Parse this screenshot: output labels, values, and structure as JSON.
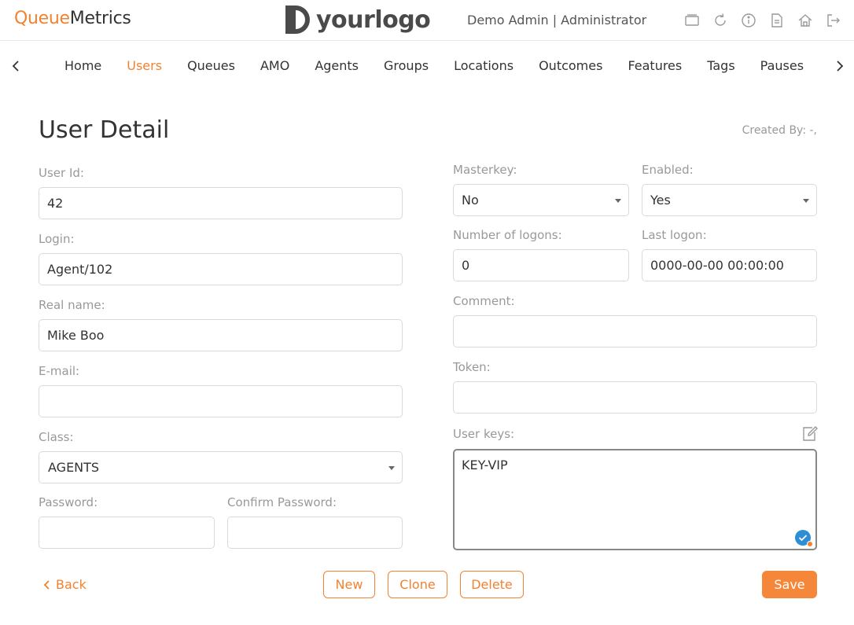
{
  "header": {
    "brand_part1": "Queue",
    "brand_part2": "Metrics",
    "logo_text": "yourlogo",
    "user_info": "Demo Admin | Administrator",
    "icons": [
      "window-icon",
      "refresh-icon",
      "info-icon",
      "document-icon",
      "home-icon",
      "logout-icon"
    ]
  },
  "nav": {
    "items": [
      {
        "label": "Home"
      },
      {
        "label": "Users",
        "active": true
      },
      {
        "label": "Queues"
      },
      {
        "label": "AMO"
      },
      {
        "label": "Agents"
      },
      {
        "label": "Groups"
      },
      {
        "label": "Locations"
      },
      {
        "label": "Outcomes"
      },
      {
        "label": "Features"
      },
      {
        "label": "Tags"
      },
      {
        "label": "Pauses"
      }
    ]
  },
  "page": {
    "title": "User Detail",
    "created_by": "Created By: -,"
  },
  "form": {
    "user_id": {
      "label": "User Id:",
      "value": "42"
    },
    "login": {
      "label": "Login:",
      "value": "Agent/102"
    },
    "real_name": {
      "label": "Real name:",
      "value": "Mike Boo"
    },
    "email": {
      "label": "E-mail:",
      "value": ""
    },
    "class": {
      "label": "Class:",
      "value": "AGENTS"
    },
    "password": {
      "label": "Password:",
      "value": ""
    },
    "confirm_password": {
      "label": "Confirm Password:",
      "value": ""
    },
    "masterkey": {
      "label": "Masterkey:",
      "value": "No"
    },
    "enabled": {
      "label": "Enabled:",
      "value": "Yes"
    },
    "logons": {
      "label": "Number of logons:",
      "value": "0"
    },
    "last_logon": {
      "label": "Last logon:",
      "value": "0000-00-00 00:00:00"
    },
    "comment": {
      "label": "Comment:",
      "value": ""
    },
    "token": {
      "label": "Token:",
      "value": ""
    },
    "user_keys": {
      "label": "User keys:",
      "value": "KEY-VIP"
    }
  },
  "actions": {
    "back": "Back",
    "new": "New",
    "clone": "Clone",
    "delete": "Delete",
    "save": "Save"
  },
  "colors": {
    "accent": "#f28230",
    "save_bg": "#f5873a",
    "badge": "#2d8ed6"
  }
}
